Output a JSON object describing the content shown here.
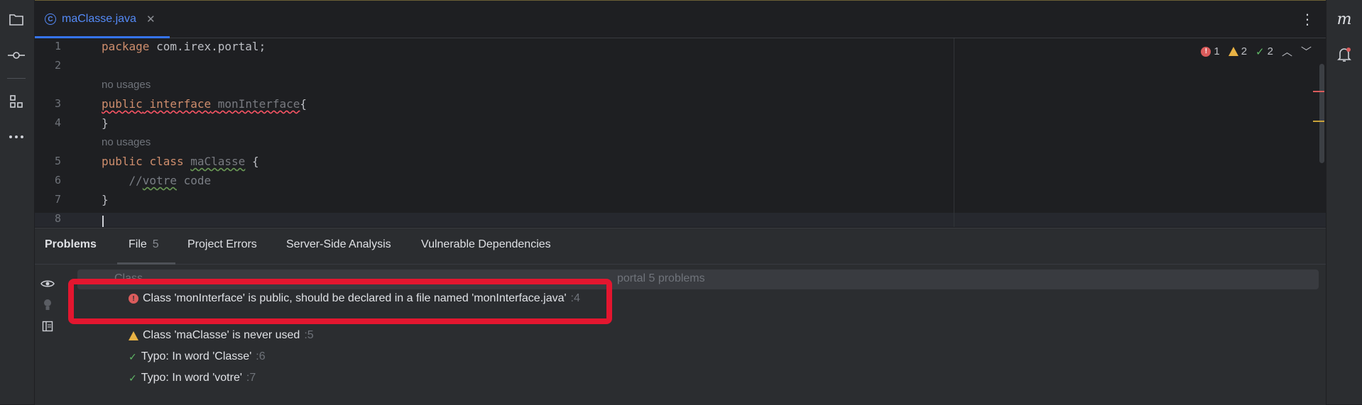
{
  "tabs": [
    {
      "label": "maClasse.java",
      "icon": "class-icon",
      "icon_glyph": "C"
    }
  ],
  "right_strip": {
    "logo": "m"
  },
  "editor": {
    "status": {
      "errors": "1",
      "warnings": "2",
      "typos": "2"
    },
    "lines": [
      {
        "n": "1",
        "code": [
          {
            "t": "package",
            "c": "kw"
          },
          {
            "t": " com.irex.portal;",
            "c": ""
          }
        ]
      },
      {
        "n": "2",
        "code": []
      },
      {
        "inlay": "no usages"
      },
      {
        "n": "3",
        "code": [
          {
            "t": "public",
            "c": "kw err"
          },
          {
            "t": " ",
            "c": "err"
          },
          {
            "t": "interface",
            "c": "kw err"
          },
          {
            "t": " ",
            "c": "err"
          },
          {
            "t": "monInterface",
            "c": "unused err"
          },
          {
            "t": "{",
            "c": ""
          }
        ]
      },
      {
        "n": "4",
        "code": [
          {
            "t": "}",
            "c": ""
          }
        ]
      },
      {
        "inlay": "no usages"
      },
      {
        "n": "5",
        "code": [
          {
            "t": "public",
            "c": "kw"
          },
          {
            "t": " ",
            "c": ""
          },
          {
            "t": "class",
            "c": "kw"
          },
          {
            "t": " ",
            "c": ""
          },
          {
            "t": "maClasse",
            "c": "unused typo"
          },
          {
            "t": " {",
            "c": ""
          }
        ]
      },
      {
        "n": "6",
        "code": [
          {
            "t": "    //",
            "c": "comment"
          },
          {
            "t": "votre",
            "c": "comment typo"
          },
          {
            "t": " code",
            "c": "comment"
          }
        ]
      },
      {
        "n": "7",
        "code": [
          {
            "t": "}",
            "c": ""
          }
        ]
      },
      {
        "n": "8",
        "code": []
      }
    ]
  },
  "problems": {
    "title": "Problems",
    "tabs": [
      {
        "label": "File",
        "count": "5"
      },
      {
        "label": "Project Errors"
      },
      {
        "label": "Server-Side Analysis"
      },
      {
        "label": "Vulnerable Dependencies"
      }
    ],
    "selected_row": {
      "left": "Class",
      "right": "portal  5 problems"
    },
    "items": [
      {
        "type": "error",
        "text": "Class 'monInterface' is public, should be declared in a file named 'monInterface.java'",
        "line": ":4"
      },
      {
        "type": "warning",
        "text": "Class 'maClasse' is never used",
        "line": ":5"
      },
      {
        "type": "typo",
        "text": "Typo: In word 'Classe'",
        "line": ":6"
      },
      {
        "type": "typo",
        "text": "Typo: In word 'votre'",
        "line": ":7"
      }
    ]
  }
}
